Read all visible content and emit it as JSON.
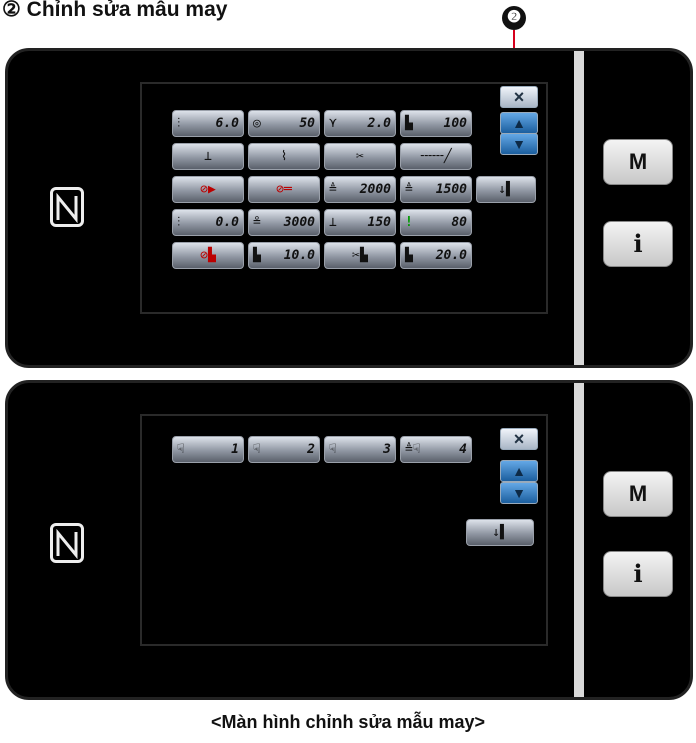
{
  "heading": "② Chỉnh sửa mẫu may",
  "callout_number": "❷",
  "panel1": {
    "side_buttons": {
      "m": "M",
      "info": "i"
    },
    "nav": {
      "close": "×",
      "up": "▲",
      "down": "▼"
    },
    "rows": [
      [
        {
          "icon": "⫶",
          "value": "6.0"
        },
        {
          "icon": "◎",
          "value": "50"
        },
        {
          "icon": "⋎",
          "value": "2.0"
        },
        {
          "icon": "▙",
          "value": "100"
        }
      ],
      [
        {
          "icon": "⊥",
          "value": ""
        },
        {
          "icon": "⌇",
          "value": ""
        },
        {
          "icon": "✂",
          "value": ""
        },
        {
          "icon": "╌╌╌╱",
          "value": ""
        }
      ],
      [
        {
          "icon": "⊘▶",
          "value": ""
        },
        {
          "icon": "⊘═",
          "value": ""
        },
        {
          "icon": "≜",
          "value": "2000"
        },
        {
          "icon": "≜",
          "value": "1500"
        },
        {
          "icon": "↓▌",
          "value": ""
        }
      ],
      [
        {
          "icon": "⫶",
          "value": "0.0"
        },
        {
          "icon": "≗",
          "value": "3000"
        },
        {
          "icon": "⊥",
          "value": "150"
        },
        {
          "icon": "!",
          "value": "80"
        }
      ],
      [
        {
          "icon": "⊘▙",
          "value": ""
        },
        {
          "icon": "▙",
          "value": "10.0"
        },
        {
          "icon": "✂▙",
          "value": ""
        },
        {
          "icon": "▙",
          "value": "20.0"
        }
      ]
    ]
  },
  "panel2": {
    "side_buttons": {
      "m": "M",
      "info": "i"
    },
    "nav": {
      "close": "×",
      "up": "▲",
      "down": "▼"
    },
    "keys": [
      {
        "icon": "☟",
        "value": "1"
      },
      {
        "icon": "☟",
        "value": "2"
      },
      {
        "icon": "☟",
        "value": "3"
      },
      {
        "icon": "≜☟",
        "value": "4"
      }
    ],
    "extra_key": {
      "icon": "↓▌",
      "value": ""
    }
  },
  "caption": "<Màn hình chỉnh sửa mẫu may>"
}
